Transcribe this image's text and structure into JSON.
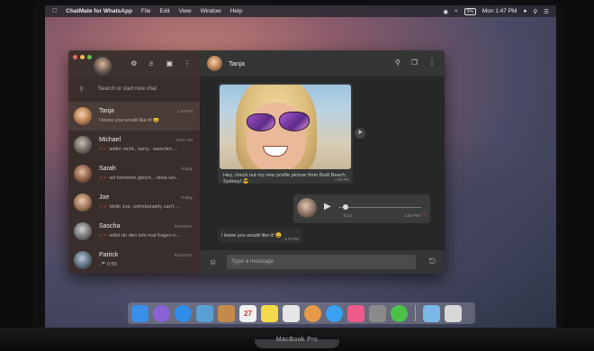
{
  "device_label": "MacBook Pro",
  "menubar": {
    "app": "ChatMate for WhatsApp",
    "items": [
      "File",
      "Edit",
      "View",
      "Window",
      "Help"
    ],
    "battery": "5%",
    "clock": "Mon 1:47 PM"
  },
  "sidebar": {
    "search_placeholder": "Search or start new chat",
    "chats": [
      {
        "name": "Tanja",
        "preview": "I knew you would like it! 😀",
        "time": "1:34 PM",
        "ticks": ""
      },
      {
        "name": "Michael",
        "preview": "leider nicht.. sorry.. www.fen…",
        "time": "10:57 AM",
        "ticks": "✓✓"
      },
      {
        "name": "Sarah",
        "preview": "wir kommen gleich... etwa um…",
        "time": "Friday",
        "ticks": "✓✓"
      },
      {
        "name": "Joe",
        "preview": "Hello Joe, unfortunately can't …",
        "time": "Friday",
        "ticks": "✓✓"
      },
      {
        "name": "Sascha",
        "preview": "willst du den tolo mal fragen o…",
        "time": "8/18/2017",
        "ticks": "✓✓"
      },
      {
        "name": "Patrick",
        "preview": "0:55",
        "time": "8/16/2017",
        "ticks": "🎤"
      }
    ]
  },
  "conversation": {
    "contact": "Tanja",
    "image_caption": "Hey, check out my new profile picture from Bodi Beach, Sydney! 😎",
    "image_time": "1:20 PM",
    "audio": {
      "current": "0:13",
      "time": "1:20 PM",
      "progress": 0.05
    },
    "text_message": "I knew you would like it! 😀",
    "text_time": "1:20 PM",
    "compose_placeholder": "Type a message"
  },
  "dock": {
    "apps": [
      "finder-icon",
      "siri-icon",
      "safari-icon",
      "mail-icon",
      "contacts-icon",
      "calendar-icon",
      "notes-icon",
      "reminders-icon",
      "photos-icon",
      "messages-icon",
      "itunes-icon",
      "system-preferences-icon",
      "chatmate-icon",
      "downloads-folder-icon",
      "trash-icon"
    ],
    "colors": [
      "#3a8ee6",
      "#8a62d8",
      "#2e8fe8",
      "#5a9fd4",
      "#c48a4a",
      "#f0f0f0",
      "#f3d84a",
      "#e6e6e6",
      "#e89a4a",
      "#3aa0f0",
      "#f05a8a",
      "#8a8a8a",
      "#4ac24a",
      "#7ab8e6",
      "#d8d8d8"
    ]
  },
  "calendar_day": "27"
}
